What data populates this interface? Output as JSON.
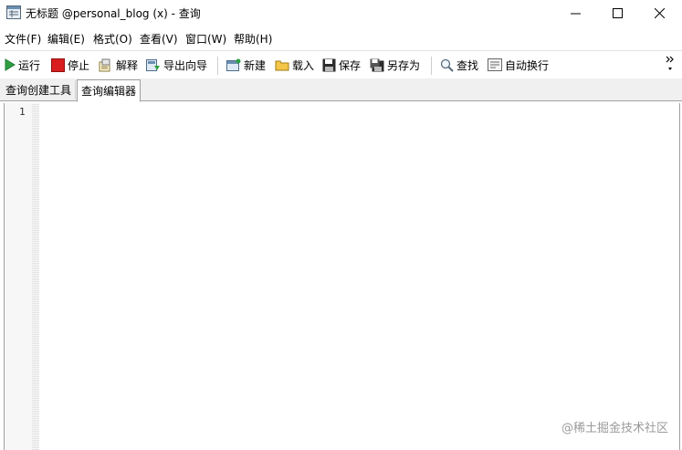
{
  "window": {
    "title": "无标题 @personal_blog (x) - 查询",
    "controls": [
      "minimize-icon",
      "maximize-icon",
      "close-icon"
    ]
  },
  "menu": {
    "items": [
      "文件(F)",
      "编辑(E)",
      "格式(O)",
      "查看(V)",
      "窗口(W)",
      "帮助(H)"
    ]
  },
  "toolbar": {
    "run": "运行",
    "stop": "停止",
    "explain": "解释",
    "export_wizard": "导出向导",
    "new": "新建",
    "load": "载入",
    "save": "保存",
    "save_as": "另存为",
    "find": "查找",
    "word_wrap": "自动换行",
    "overflow_icon": "chevron-double-right-icon"
  },
  "tabs": {
    "items": [
      "查询创建工具",
      "查询编辑器"
    ],
    "active": "查询编辑器"
  },
  "editor": {
    "line_number": "1",
    "content": ""
  },
  "watermark": "@稀土掘金技术社区",
  "colors": {
    "run_green": "#2ea043",
    "stop_red": "#d81e1e",
    "border": "#a0a0a0",
    "tab_bar": "#f0f0f0"
  }
}
